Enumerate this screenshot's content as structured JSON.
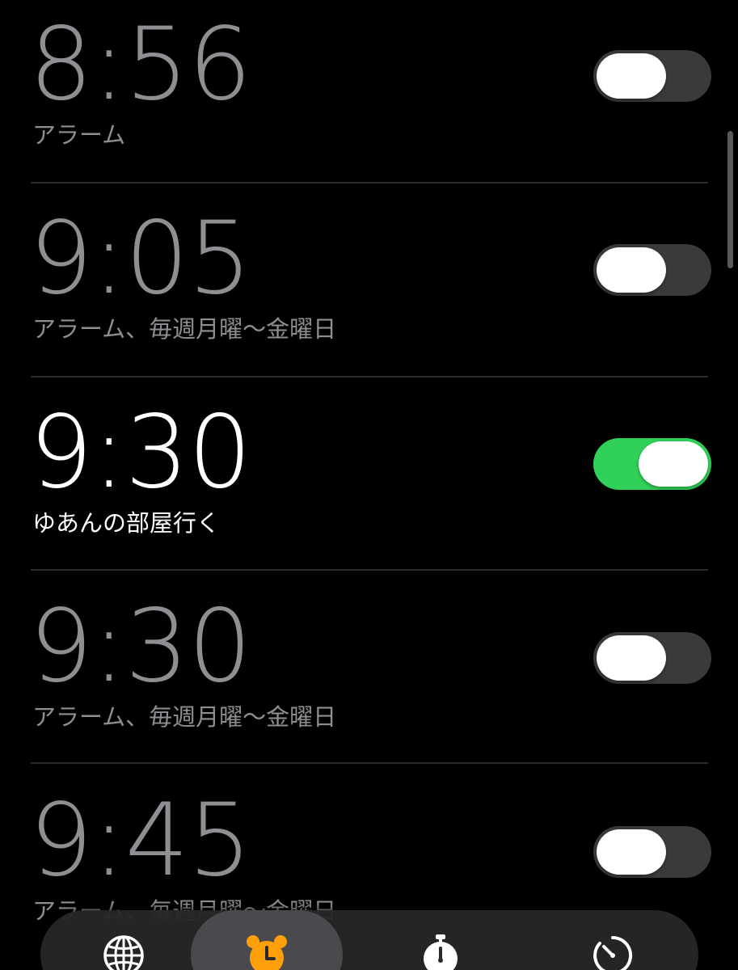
{
  "alarms": [
    {
      "time": "8:56",
      "label": "アラーム",
      "enabled": false
    },
    {
      "time": "9:05",
      "label": "アラーム、毎週月曜〜金曜日",
      "enabled": false
    },
    {
      "time": "9:30",
      "label": "ゆあんの部屋行く",
      "enabled": true
    },
    {
      "time": "9:30",
      "label": "アラーム、毎週月曜〜金曜日",
      "enabled": false
    },
    {
      "time": "9:45",
      "label": "アラーム、毎週月曜〜金曜日",
      "enabled": false
    }
  ],
  "tabbar": {
    "tabs": [
      {
        "icon": "globe-icon",
        "selected": false
      },
      {
        "icon": "alarm-clock-icon",
        "selected": true
      },
      {
        "icon": "stopwatch-icon",
        "selected": false
      },
      {
        "icon": "timer-icon",
        "selected": false
      }
    ]
  },
  "colors": {
    "background": "#000000",
    "text_on": "#ffffff",
    "text_off": "#8e8e93",
    "toggle_on": "#30d158",
    "toggle_off": "#3a3a3c",
    "accent": "#ff9f0a"
  }
}
